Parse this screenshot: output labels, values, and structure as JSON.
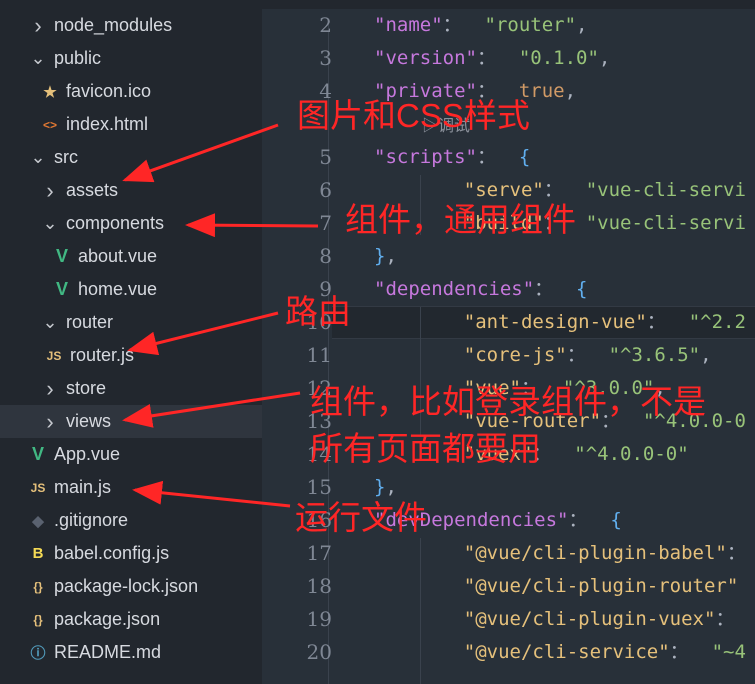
{
  "explorer": {
    "items": [
      {
        "label": "node_modules",
        "type": "folder",
        "open": false
      },
      {
        "label": "public",
        "type": "folder",
        "open": true
      },
      {
        "label": "favicon.ico",
        "type": "file",
        "icon": "star-icon"
      },
      {
        "label": "index.html",
        "type": "file",
        "icon": "html-icon"
      },
      {
        "label": "src",
        "type": "folder",
        "open": true
      },
      {
        "label": "assets",
        "type": "folder",
        "open": false
      },
      {
        "label": "components",
        "type": "folder",
        "open": true
      },
      {
        "label": "about.vue",
        "type": "file",
        "icon": "vue-icon"
      },
      {
        "label": "home.vue",
        "type": "file",
        "icon": "vue-icon"
      },
      {
        "label": "router",
        "type": "folder",
        "open": true
      },
      {
        "label": "router.js",
        "type": "file",
        "icon": "js-icon",
        "badge": "JS"
      },
      {
        "label": "store",
        "type": "folder",
        "open": false
      },
      {
        "label": "views",
        "type": "folder",
        "open": false,
        "selected": true
      },
      {
        "label": "App.vue",
        "type": "file",
        "icon": "vue-icon"
      },
      {
        "label": "main.js",
        "type": "file",
        "icon": "js-icon",
        "badge": "JS"
      },
      {
        "label": ".gitignore",
        "type": "file",
        "icon": "git-icon"
      },
      {
        "label": "babel.config.js",
        "type": "file",
        "icon": "babel-icon"
      },
      {
        "label": "package-lock.json",
        "type": "file",
        "icon": "json-icon",
        "badge": "{}"
      },
      {
        "label": "package.json",
        "type": "file",
        "icon": "json-icon",
        "badge": "{}"
      },
      {
        "label": "README.md",
        "type": "file",
        "icon": "info-icon"
      }
    ]
  },
  "editor": {
    "codelens": "调试",
    "lines": [
      {
        "n": "2",
        "code": [
          [
            "k",
            "\"name\""
          ],
          [
            "",
            "：  "
          ],
          [
            "s",
            "\"router\""
          ],
          [
            "",
            ","
          ]
        ]
      },
      {
        "n": "3",
        "code": [
          [
            "k",
            "\"version\""
          ],
          [
            "",
            "：  "
          ],
          [
            "s",
            "\"0.1.0\""
          ],
          [
            "",
            ","
          ]
        ]
      },
      {
        "n": "4",
        "code": [
          [
            "k",
            "\"private\""
          ],
          [
            "",
            "：  "
          ],
          [
            "o",
            "true"
          ],
          [
            "",
            ","
          ]
        ]
      },
      {
        "n": "5",
        "code": [
          [
            "k",
            "\"scripts\""
          ],
          [
            "",
            "：  "
          ],
          [
            "p",
            "{"
          ]
        ]
      },
      {
        "n": "6",
        "code": [
          [
            "",
            "    "
          ],
          [
            "b",
            "\"serve\""
          ],
          [
            "",
            "：  "
          ],
          [
            "s",
            "\"vue-cli-servi"
          ]
        ]
      },
      {
        "n": "7",
        "code": [
          [
            "",
            "    "
          ],
          [
            "b",
            "\"build\""
          ],
          [
            "",
            "：  "
          ],
          [
            "s",
            "\"vue-cli-servi"
          ]
        ]
      },
      {
        "n": "8",
        "code": [
          [
            "p",
            "}"
          ],
          [
            "",
            ","
          ]
        ]
      },
      {
        "n": "9",
        "code": [
          [
            "k",
            "\"dependencies\""
          ],
          [
            "",
            "：  "
          ],
          [
            "p",
            "{"
          ]
        ]
      },
      {
        "n": "10",
        "code": [
          [
            "",
            "    "
          ],
          [
            "b",
            "\"ant-design-vue\""
          ],
          [
            "",
            "：  "
          ],
          [
            "s",
            "\"^2.2"
          ]
        ]
      },
      {
        "n": "11",
        "code": [
          [
            "",
            "    "
          ],
          [
            "b",
            "\"core-js\""
          ],
          [
            "",
            "：  "
          ],
          [
            "s",
            "\"^3.6.5\""
          ],
          [
            "",
            ","
          ]
        ]
      },
      {
        "n": "12",
        "code": [
          [
            "",
            "    "
          ],
          [
            "b",
            "\"vue\""
          ],
          [
            "",
            "：  "
          ],
          [
            "s",
            "\"^3.0.0\""
          ],
          [
            "",
            ","
          ]
        ]
      },
      {
        "n": "13",
        "code": [
          [
            "",
            "    "
          ],
          [
            "b",
            "\"vue-router\""
          ],
          [
            "",
            "：  "
          ],
          [
            "s",
            "\"^4.0.0-0"
          ]
        ]
      },
      {
        "n": "14",
        "code": [
          [
            "",
            "    "
          ],
          [
            "b",
            "\"vuex\""
          ],
          [
            "",
            "：  "
          ],
          [
            "s",
            "\"^4.0.0-0\""
          ]
        ]
      },
      {
        "n": "15",
        "code": [
          [
            "p",
            "}"
          ],
          [
            "",
            ","
          ]
        ]
      },
      {
        "n": "16",
        "code": [
          [
            "k",
            "\"devDependencies\""
          ],
          [
            "",
            "：  "
          ],
          [
            "p",
            "{"
          ]
        ]
      },
      {
        "n": "17",
        "code": [
          [
            "",
            "    "
          ],
          [
            "b",
            "\"@vue/cli-plugin-babel\""
          ],
          [
            "",
            "："
          ]
        ]
      },
      {
        "n": "18",
        "code": [
          [
            "",
            "    "
          ],
          [
            "b",
            "\"@vue/cli-plugin-router\""
          ]
        ]
      },
      {
        "n": "19",
        "code": [
          [
            "",
            "    "
          ],
          [
            "b",
            "\"@vue/cli-plugin-vuex\""
          ],
          [
            "",
            "："
          ]
        ]
      },
      {
        "n": "20",
        "code": [
          [
            "",
            "    "
          ],
          [
            "b",
            "\"@vue/cli-service\""
          ],
          [
            "",
            "：  "
          ],
          [
            "s",
            "\"~4"
          ]
        ]
      }
    ]
  },
  "annotations": {
    "assets": "图片和CSS样式",
    "components": "组件，通用组件",
    "router": "路由",
    "views_1": "组件，比如登录组件，不是",
    "views_2": "所有页面都要用",
    "main": "运行文件",
    "color": "#ff2626"
  }
}
